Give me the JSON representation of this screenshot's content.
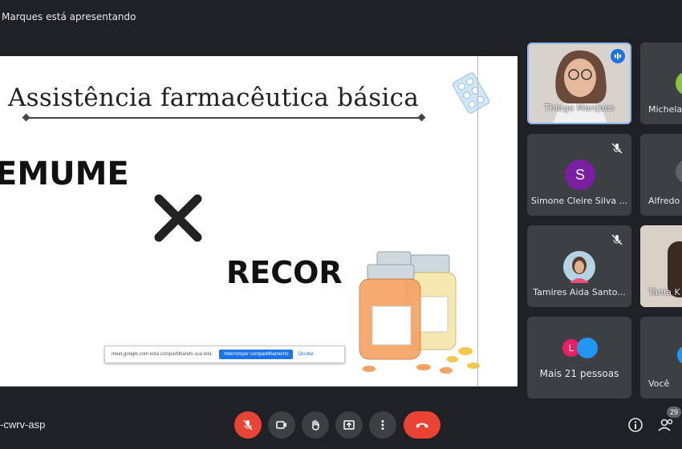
{
  "header": {
    "presenter_text": "Marques está apresentando"
  },
  "slide": {
    "title": "Assistência farmacêutica básica",
    "left_word": "EMUME",
    "right_word": "RECOR",
    "share_bar": {
      "message": "meet.google.com está compartilhando sua tela.",
      "stop_label": "Interromper compartilhamento",
      "hide_label": "Ocultar"
    }
  },
  "participants": [
    {
      "name": "Thiago Marques"
    },
    {
      "name": "Michela"
    },
    {
      "name": "Simone Cleire Silva ...",
      "initial": "S"
    },
    {
      "name": "Alfredo"
    },
    {
      "name": "Tamires Aida Santo..."
    },
    {
      "name": "Tânia K"
    },
    {
      "name": "Mais 21 pessoas",
      "initial": "L"
    },
    {
      "name": "Você"
    }
  ],
  "footer": {
    "meeting_code": "-cwrv-asp",
    "participant_count": "29"
  },
  "colors": {
    "accent": "#1a73e8",
    "danger": "#ea4335",
    "tile": "#3c4043"
  }
}
